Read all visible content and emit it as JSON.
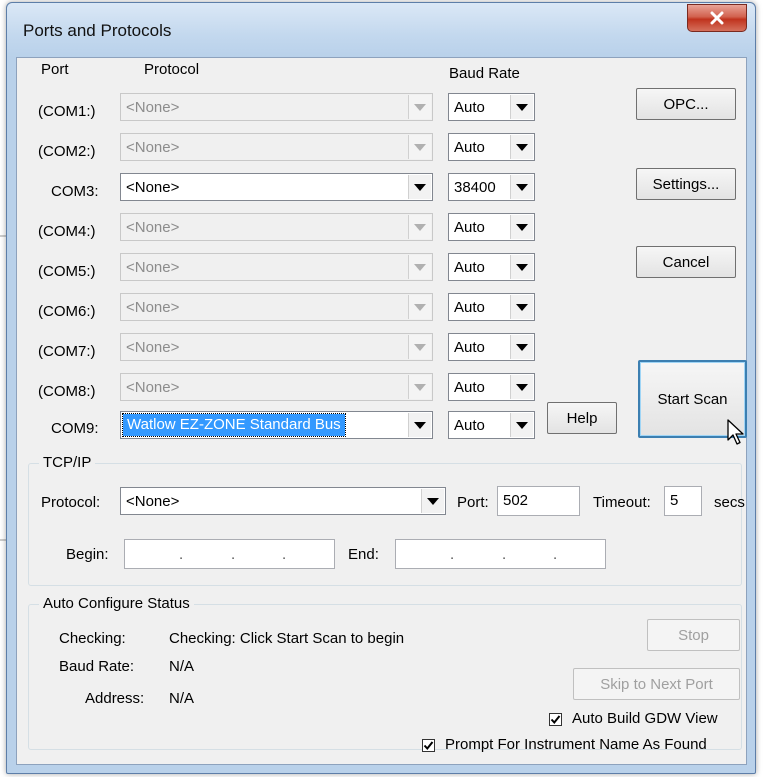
{
  "window": {
    "title": "Ports and Protocols"
  },
  "columns": {
    "port": "Port",
    "protocol": "Protocol",
    "baud": "Baud Rate"
  },
  "rows": [
    {
      "port": "(COM1:)",
      "protocol": "<None>",
      "baud": "Auto",
      "enabled": false
    },
    {
      "port": "(COM2:)",
      "protocol": "<None>",
      "baud": "Auto",
      "enabled": false
    },
    {
      "port": "COM3:",
      "protocol": "<None>",
      "baud": "38400",
      "enabled": true
    },
    {
      "port": "(COM4:)",
      "protocol": "<None>",
      "baud": "Auto",
      "enabled": false
    },
    {
      "port": "(COM5:)",
      "protocol": "<None>",
      "baud": "Auto",
      "enabled": false
    },
    {
      "port": "(COM6:)",
      "protocol": "<None>",
      "baud": "Auto",
      "enabled": false
    },
    {
      "port": "(COM7:)",
      "protocol": "<None>",
      "baud": "Auto",
      "enabled": false
    },
    {
      "port": "(COM8:)",
      "protocol": "<None>",
      "baud": "Auto",
      "enabled": false
    },
    {
      "port": "COM9:",
      "protocol": "Watlow EZ-ZONE Standard Bus",
      "baud": "Auto",
      "enabled": true
    }
  ],
  "buttons": {
    "opc": "OPC...",
    "settings": "Settings...",
    "cancel": "Cancel",
    "start_scan": "Start Scan",
    "help": "Help",
    "stop": "Stop",
    "skip": "Skip to Next Port"
  },
  "tcpip": {
    "title": "TCP/IP",
    "protocol_label": "Protocol:",
    "protocol_value": "<None>",
    "port_label": "Port:",
    "port_value": "502",
    "timeout_label": "Timeout:",
    "timeout_value": "5",
    "secs_label": "secs",
    "begin_label": "Begin:",
    "end_label": "End:"
  },
  "status": {
    "title": "Auto Configure Status",
    "checking_label": "Checking:",
    "checking_value": "Checking: Click Start Scan to begin",
    "baud_label": "Baud Rate:",
    "baud_value": "N/A",
    "address_label": "Address:",
    "address_value": "N/A"
  },
  "options": {
    "auto_build": {
      "label": "Auto Build GDW View",
      "checked": true
    },
    "prompt_name": {
      "label": "Prompt For Instrument Name As Found",
      "checked": true
    }
  }
}
